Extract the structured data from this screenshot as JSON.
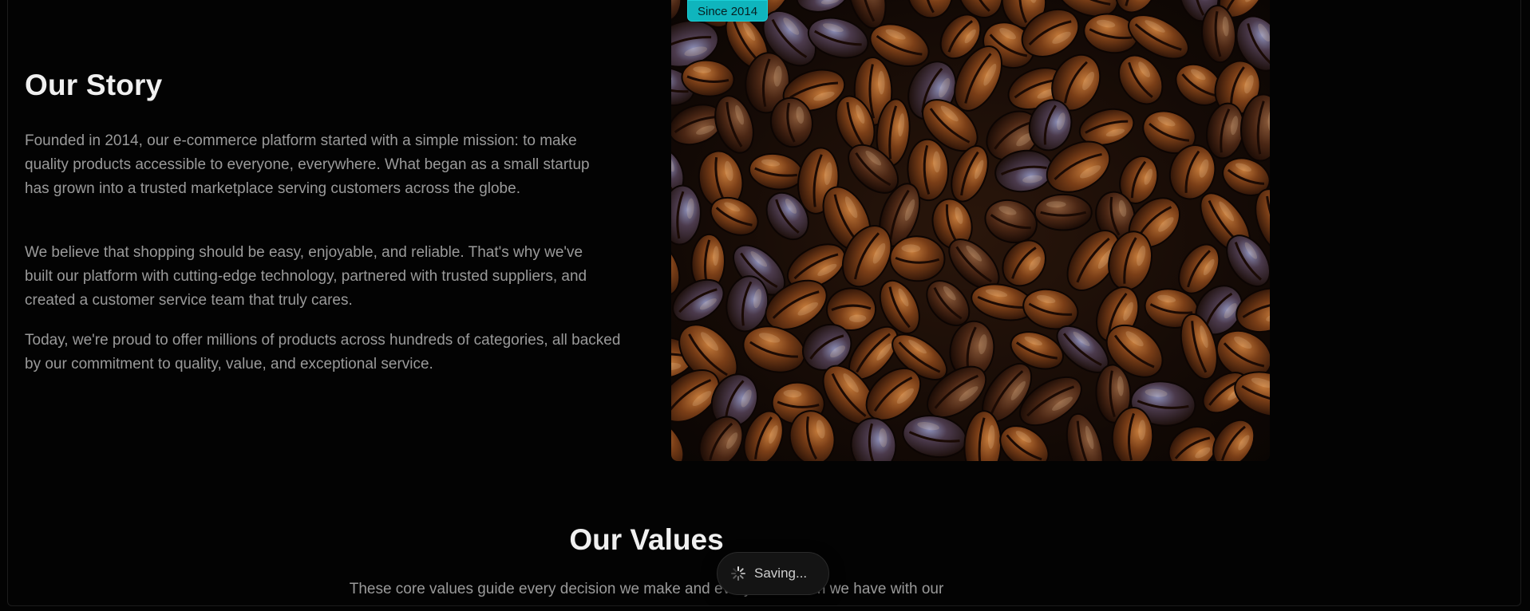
{
  "story": {
    "title": "Our Story",
    "paragraphs": [
      "Founded in 2014, our e-commerce platform started with a simple mission: to make quality products accessible to everyone, everywhere. What began as a small startup has grown into a trusted marketplace serving customers across the globe.",
      "We believe that shopping should be easy, enjoyable, and reliable. That's why we've built our platform with cutting-edge technology, partnered with trusted suppliers, and created a customer service team that truly cares.",
      "Today, we're proud to offer millions of products across hundreds of categories, all backed by our commitment to quality, value, and exceptional service."
    ],
    "badge": "Since 2014",
    "image_subject": "roasted coffee beans"
  },
  "values": {
    "title": "Our Values",
    "intro": "These core values guide every decision we make and every interaction we have with our"
  },
  "toast": {
    "label": "Saving...",
    "icon": "spinner-icon"
  },
  "colors": {
    "background": "#030303",
    "badge": "#0fb5bd",
    "heading": "#f0f0f0",
    "body_text": "#9a9a9a"
  }
}
